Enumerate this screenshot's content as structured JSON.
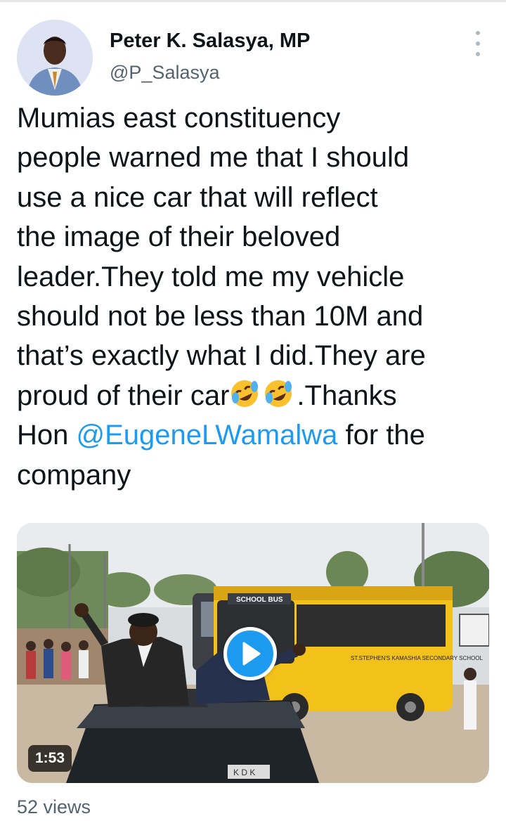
{
  "author": {
    "name": "Peter K. Salasya, MP",
    "handle": "@P_Salasya"
  },
  "more_icon": "more-vertical-icon",
  "tweet": {
    "lines": [
      "Mumias east constituency",
      "people warned me that I should",
      "use a nice car that will reflect",
      "the image of their beloved",
      "leader.They told me my vehicle",
      "should not be less than 10M and",
      "that’s exactly what I did.They are"
    ],
    "line8_prefix": "proud of their car",
    "line8_suffix": ".Thanks",
    "emoji_name": "rolling-on-the-floor-laughing-emoji",
    "line9_prefix": "Hon ",
    "mention": "@EugeneLWamalwa",
    "line9_suffix": " for the",
    "line10": "company"
  },
  "media": {
    "type": "video",
    "duration": "1:53",
    "bus_sign": "SCHOOL BUS",
    "bus_text": "ST.STEPHEN'S KAMASHIA SECONDARY SCHOOL",
    "plate_text": "K D K",
    "play_icon": "play-icon"
  },
  "footer": {
    "views": "52 views"
  },
  "colors": {
    "accent": "#1d9bf0",
    "text": "#0f1419",
    "secondary": "#536471"
  }
}
